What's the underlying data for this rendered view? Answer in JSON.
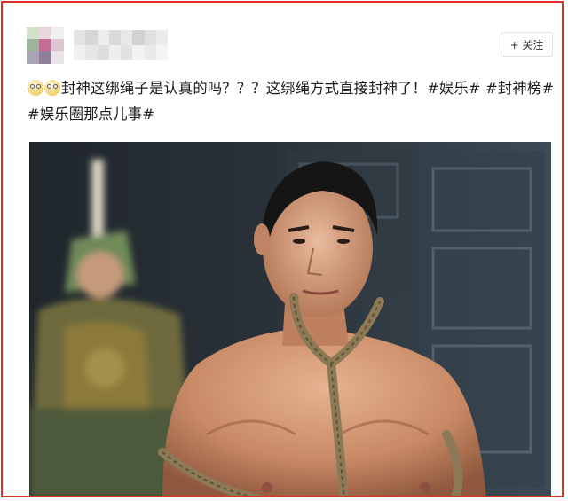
{
  "post": {
    "text_part1": "封神这绑绳子是认真的吗？？？这绑绳方式直接封神了！#娱乐# #封神榜# #娱乐圈那点儿事#",
    "emoji_names": [
      "dizzy-face-icon",
      "dizzy-face-icon"
    ]
  },
  "header": {
    "follow_label": "+ 关注"
  },
  "colors": {
    "border": "#e0302b",
    "text": "#1a1a1a"
  },
  "image": {
    "subject": "shirtless-man-bound-with-rope-icon",
    "background_figure": "armored-soldier-icon"
  }
}
